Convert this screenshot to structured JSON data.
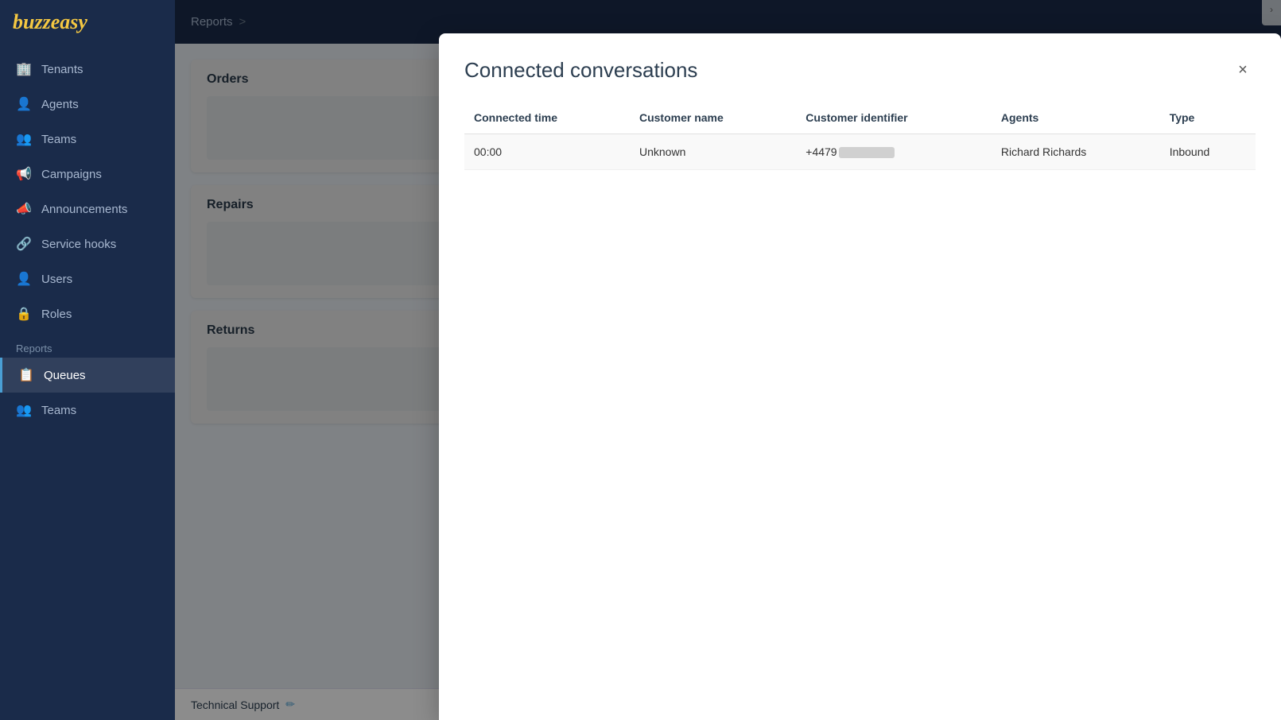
{
  "app": {
    "logo": "buzzeasy",
    "colors": {
      "sidebar_bg": "#1a2b4a",
      "accent": "#4a9fd4",
      "logo_color": "#f5c842"
    }
  },
  "sidebar": {
    "items": [
      {
        "id": "tenants",
        "label": "Tenants",
        "icon": "🏢",
        "active": false
      },
      {
        "id": "agents",
        "label": "Agents",
        "icon": "👤",
        "active": false
      },
      {
        "id": "teams",
        "label": "Teams",
        "icon": "👥",
        "active": false
      },
      {
        "id": "campaigns",
        "label": "Campaigns",
        "icon": "📢",
        "active": false
      },
      {
        "id": "announcements",
        "label": "Announcements",
        "icon": "📣",
        "active": false
      },
      {
        "id": "service-hooks",
        "label": "Service hooks",
        "icon": "🔗",
        "active": false
      },
      {
        "id": "users",
        "label": "Users",
        "icon": "👤",
        "active": false
      },
      {
        "id": "roles",
        "label": "Roles",
        "icon": "🔒",
        "active": false
      }
    ],
    "sections": [
      {
        "label": "Reports",
        "items": [
          {
            "id": "queues",
            "label": "Queues",
            "icon": "📋",
            "active": true
          },
          {
            "id": "teams-reports",
            "label": "Teams",
            "icon": "👥",
            "active": false
          }
        ]
      }
    ]
  },
  "breadcrumb": {
    "items": [
      "Reports",
      ">"
    ]
  },
  "background_cards": [
    {
      "id": "orders",
      "title": "Orders"
    },
    {
      "id": "repairs",
      "title": "Repairs"
    },
    {
      "id": "returns",
      "title": "Returns"
    }
  ],
  "modal": {
    "title": "Connected conversations",
    "close_label": "×",
    "table": {
      "columns": [
        {
          "id": "connected-time",
          "label": "Connected time"
        },
        {
          "id": "customer-name",
          "label": "Customer name"
        },
        {
          "id": "customer-identifier",
          "label": "Customer identifier"
        },
        {
          "id": "agents",
          "label": "Agents"
        },
        {
          "id": "type",
          "label": "Type"
        }
      ],
      "rows": [
        {
          "connected_time": "00:00",
          "customer_name": "Unknown",
          "customer_identifier_prefix": "+4479",
          "customer_identifier_blurred": true,
          "agents": "Richard Richards",
          "type": "Inbound"
        }
      ]
    }
  },
  "tech_support": {
    "label": "Technical Support",
    "edit_icon": "✏"
  }
}
